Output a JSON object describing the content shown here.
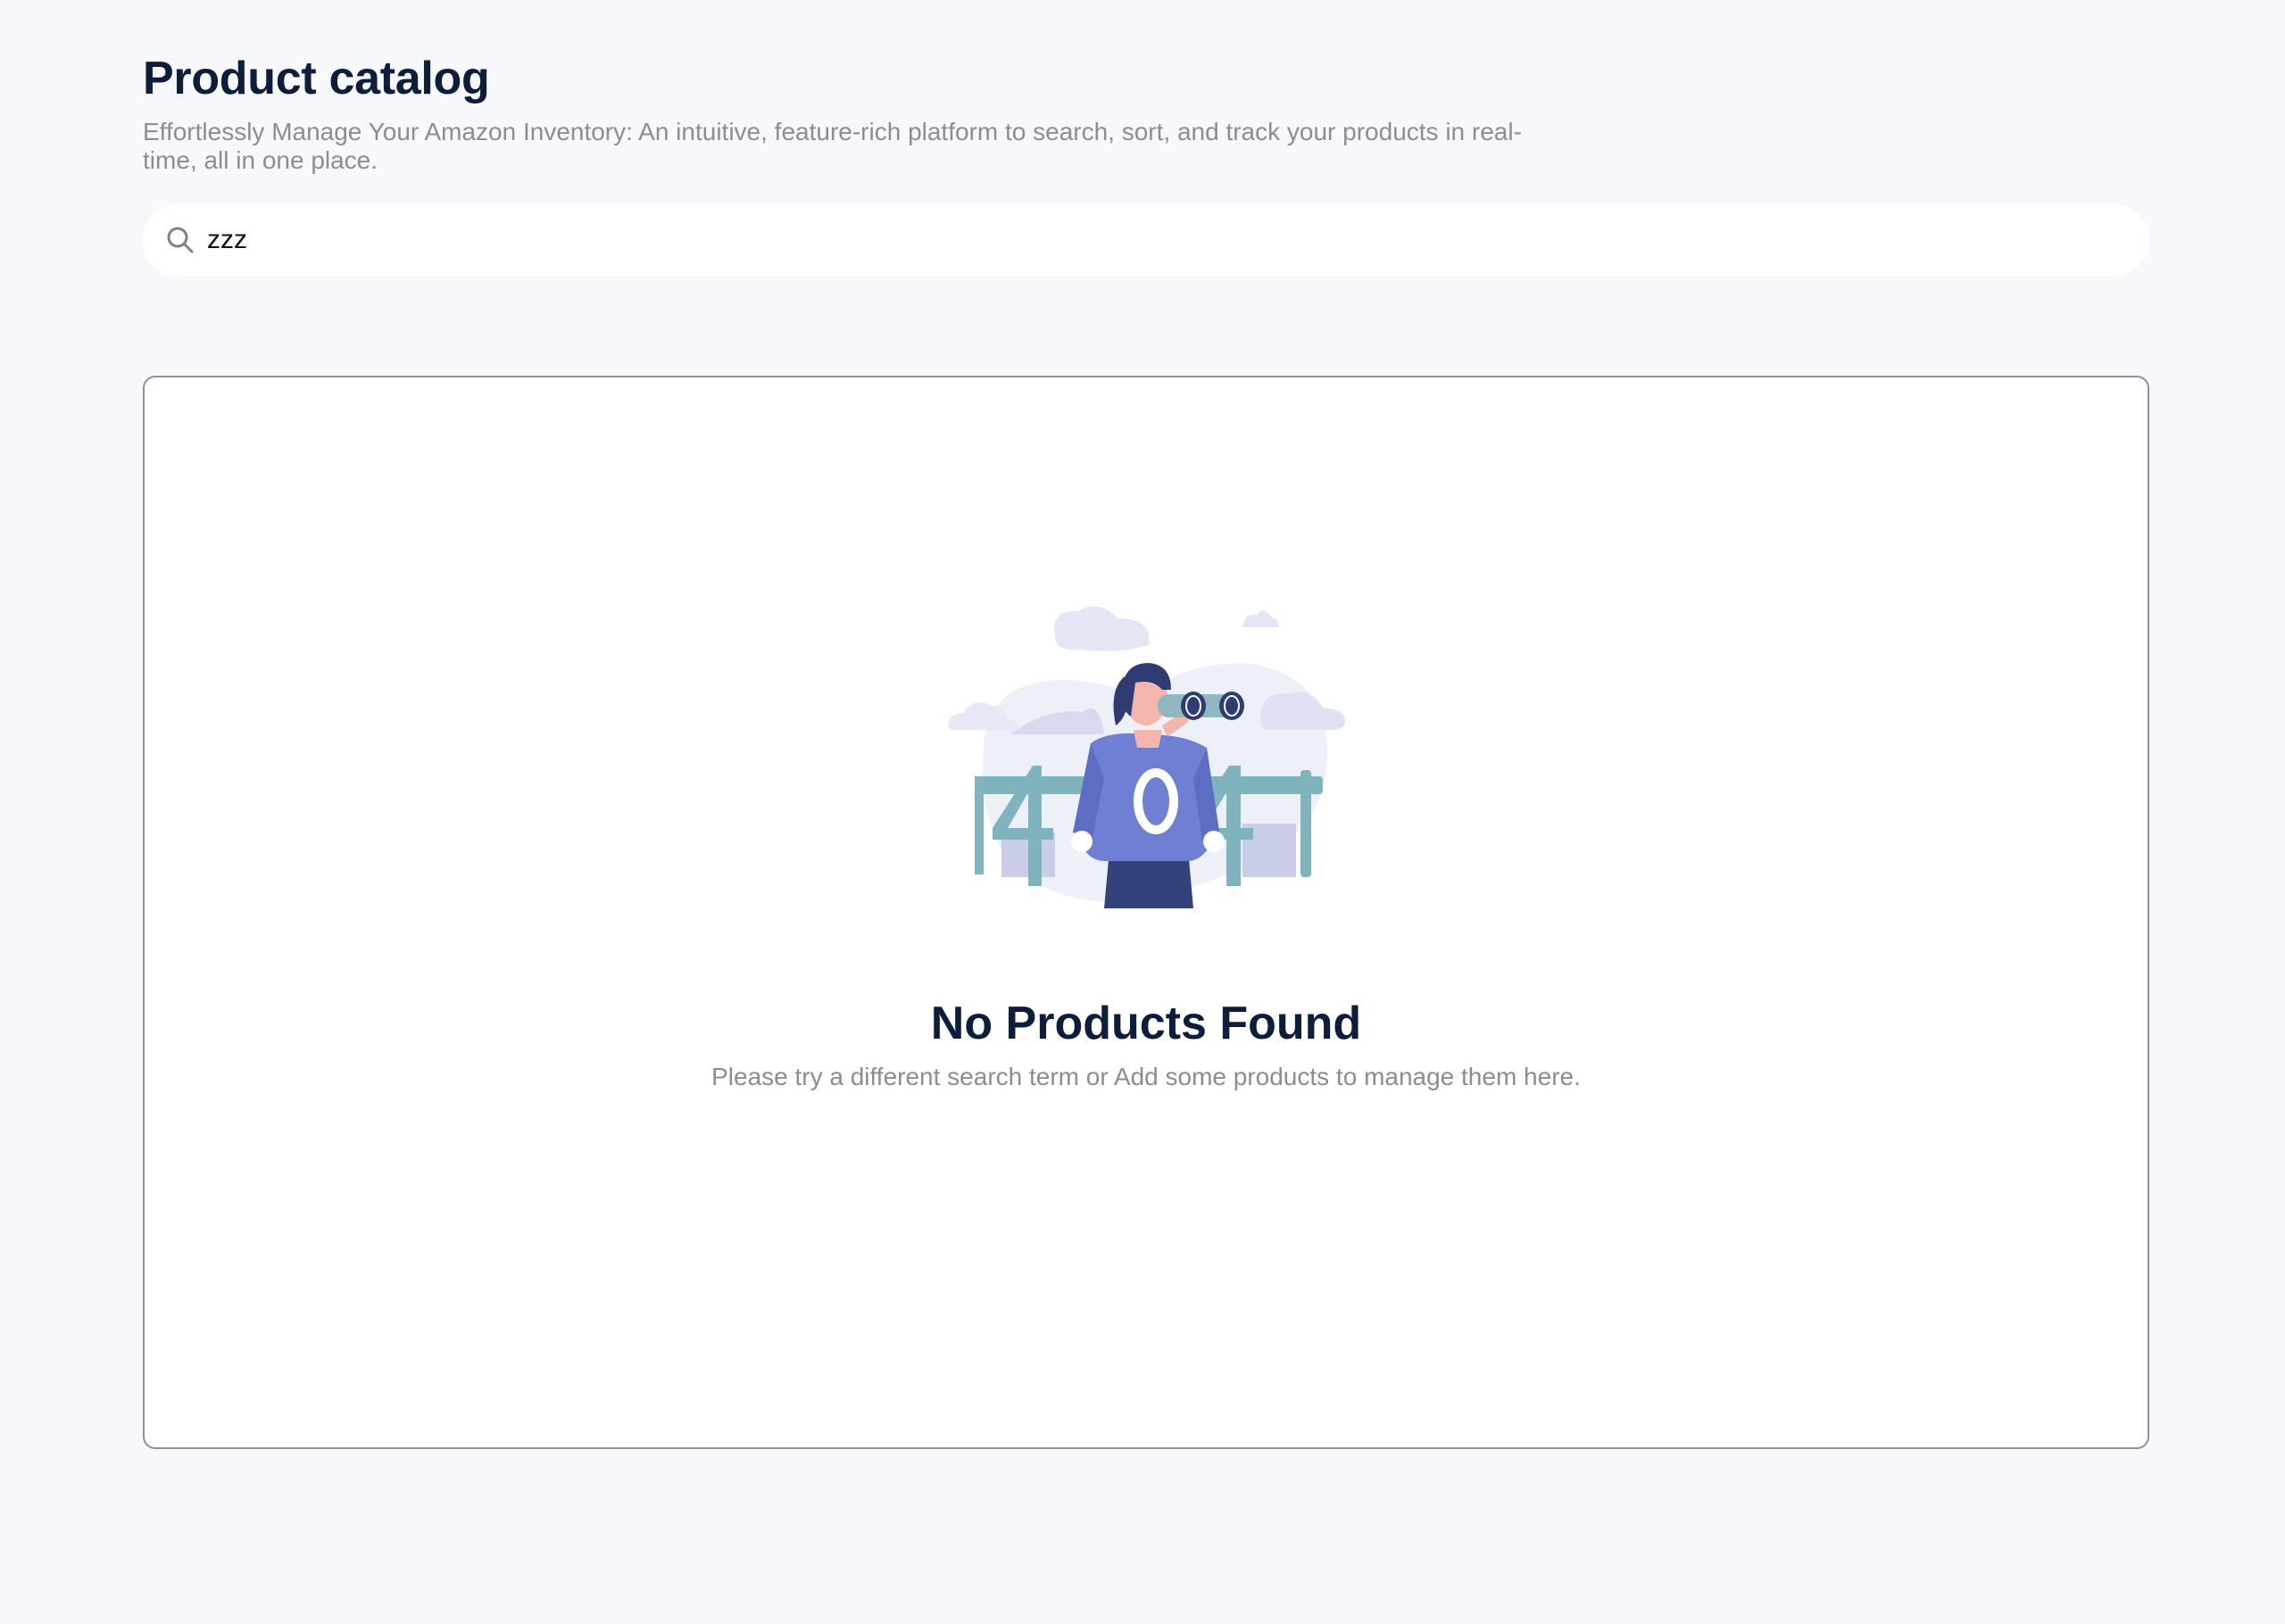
{
  "header": {
    "title": "Product catalog",
    "subtitle": "Effortlessly Manage Your Amazon Inventory: An intuitive, feature-rich platform to search, sort, and track your products in real-time, all in one place."
  },
  "search": {
    "value": "zzz",
    "icon": "search-icon"
  },
  "empty_state": {
    "illustration": "404-woman-with-binoculars-illustration",
    "illustration_text": "404",
    "title": "No Products Found",
    "message": "Please try a different search term or Add some products to manage them here."
  },
  "colors": {
    "background": "#f7f8fb",
    "heading": "#0c1e3c",
    "muted_text": "#8a8d94",
    "panel_border": "#8f9196",
    "illustration_primary": "#6f7fd3",
    "illustration_teal": "#7fb3bd"
  }
}
